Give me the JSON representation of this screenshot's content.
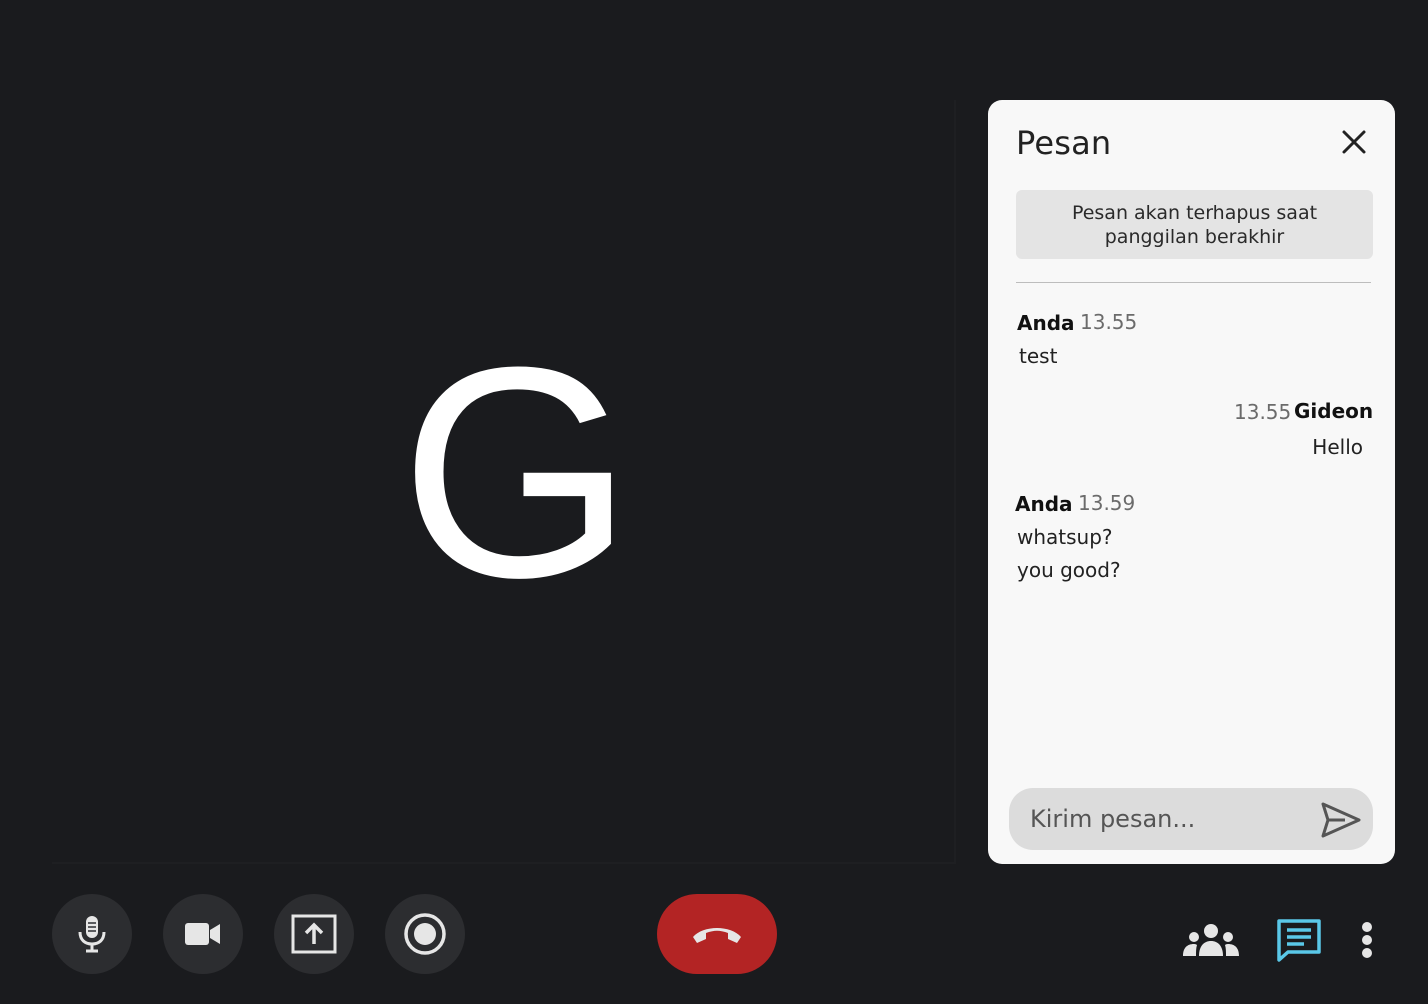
{
  "participant": {
    "initial": "G"
  },
  "chat": {
    "title": "Pesan",
    "notice": "Pesan akan terhapus saat panggilan berakhir",
    "messages": [
      {
        "sender": "Anda",
        "time": "13.55",
        "lines": [
          "test"
        ],
        "align": "left"
      },
      {
        "sender": "Gideon",
        "time": "13.55",
        "lines": [
          "Hello"
        ],
        "align": "right"
      },
      {
        "sender": "Anda",
        "time": "13.59",
        "lines": [
          "whatsup?",
          "you good?"
        ],
        "align": "left"
      }
    ],
    "input_placeholder": "Kirim pesan..."
  },
  "toolbar": {
    "left": [
      "mic-icon",
      "camera-icon",
      "present-screen-icon",
      "record-icon"
    ],
    "center": "end-call-icon",
    "right": [
      "participants-icon",
      "chat-icon",
      "more-vert-icon"
    ]
  },
  "colors": {
    "background": "#1a1b1e",
    "button": "#2c2d30",
    "end_call": "#b32424",
    "chat_active": "#5ac8e8",
    "panel": "#f8f8f8"
  }
}
